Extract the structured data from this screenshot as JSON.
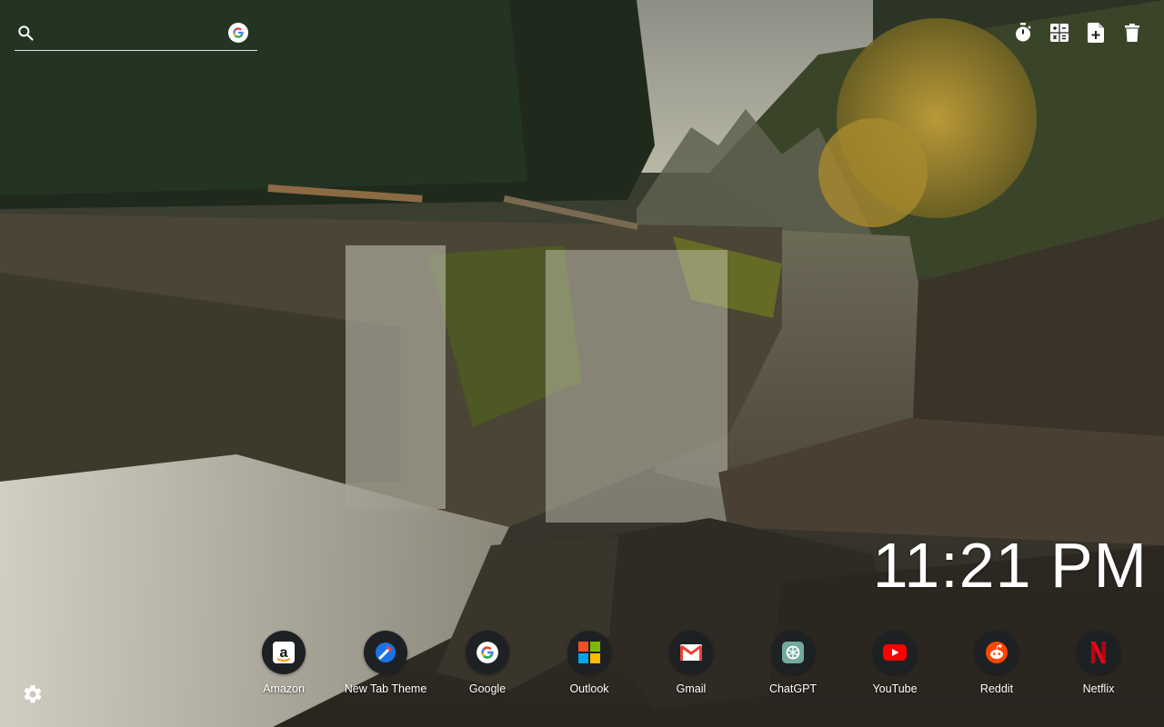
{
  "search": {
    "placeholder": "",
    "value": "",
    "engine_icon": "google-g-icon"
  },
  "tools": [
    {
      "name": "timer-icon"
    },
    {
      "name": "calculator-icon"
    },
    {
      "name": "new-note-icon"
    },
    {
      "name": "trash-icon"
    }
  ],
  "clock": {
    "time": "11:21 PM"
  },
  "shortcuts": [
    {
      "label": "Amazon",
      "icon": "amazon-icon"
    },
    {
      "label": "New Tab Theme",
      "icon": "new-tab-theme-icon"
    },
    {
      "label": "Google",
      "icon": "google-icon"
    },
    {
      "label": "Outlook",
      "icon": "outlook-icon"
    },
    {
      "label": "Gmail",
      "icon": "gmail-icon"
    },
    {
      "label": "ChatGPT",
      "icon": "chatgpt-icon"
    },
    {
      "label": "YouTube",
      "icon": "youtube-icon"
    },
    {
      "label": "Reddit",
      "icon": "reddit-icon"
    },
    {
      "label": "Netflix",
      "icon": "netflix-icon"
    }
  ],
  "settings": {
    "icon": "gear-icon"
  },
  "colors": {
    "shortcut_bg": "#1e2124",
    "text": "#ffffff"
  }
}
